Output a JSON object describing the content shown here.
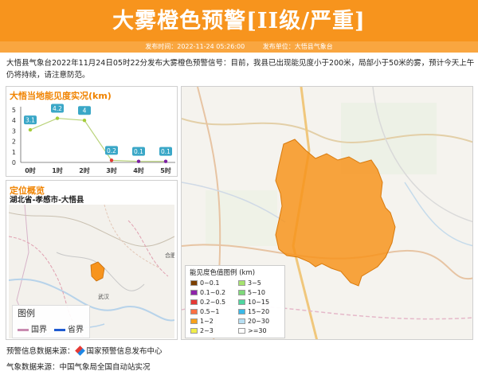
{
  "header": {
    "title": "大雾橙色预警[II级/严重]",
    "publish_time": "发布时间：2022-11-24 05:26:00",
    "publisher": "发布单位：大悟县气象台"
  },
  "description": "大悟县气象台2022年11月24日05时22分发布大雾橙色预警信号：目前，我县已出现能见度小于200米，局部小于50米的雾，预计今天上午仍将持续，请注意防范。",
  "visibility_panel": {
    "title": "大悟当地能见度实况(km)"
  },
  "chart_data": {
    "type": "line",
    "title": "大悟当地能见度实况(km)",
    "categories": [
      "0时",
      "1时",
      "2时",
      "3时",
      "4时",
      "5时"
    ],
    "values": [
      3.1,
      4.2,
      4,
      0.2,
      0.1,
      0.1
    ],
    "value_labels": [
      "3.1",
      "4.2",
      "4",
      "0.2",
      "0.1",
      "0.1"
    ],
    "ylim": [
      0,
      5
    ],
    "yticks": [
      "0",
      "1",
      "2",
      "3",
      "4",
      "5"
    ],
    "grid": false,
    "colors": {
      "line": "#b9d37a",
      "point_high": "#a5cc3a",
      "point_low": "#7b1fa2",
      "point_mid": "#e53935",
      "label_bg": "#3aa7c7"
    }
  },
  "location_panel": {
    "title": "定位概览",
    "region": "湖北省-孝感市-大悟县",
    "map_labels": {
      "hefei": "合肥",
      "wuhan": "武汉"
    },
    "legend": {
      "title": "图例",
      "national": "国界",
      "provincial": "省界"
    }
  },
  "main_map": {
    "legend_title": "能见度色值图例 (km)",
    "legend": [
      {
        "label": "0~0.1",
        "color": "#7b3f00"
      },
      {
        "label": "3~5",
        "color": "#a6e36f"
      },
      {
        "label": "0.1~0.2",
        "color": "#8e24aa"
      },
      {
        "label": "5~10",
        "color": "#7ed87a"
      },
      {
        "label": "0.2~0.5",
        "color": "#e53935"
      },
      {
        "label": "10~15",
        "color": "#4fd6a0"
      },
      {
        "label": "0.5~1",
        "color": "#ff7043"
      },
      {
        "label": "15~20",
        "color": "#3bb9e8"
      },
      {
        "label": "1~2",
        "color": "#f7a11a"
      },
      {
        "label": "20~30",
        "color": "#b7dff2"
      },
      {
        "label": "2~3",
        "color": "#f1ee4a"
      },
      {
        "label": ">=30",
        "color": "#ffffff"
      }
    ],
    "county_color": "#f7941d"
  },
  "footer": {
    "warning_source": "预警信息数据来源：",
    "warning_source_name": "国家预警信息发布中心",
    "weather_source": "气象数据来源：中国气象局全国自动站实况"
  }
}
